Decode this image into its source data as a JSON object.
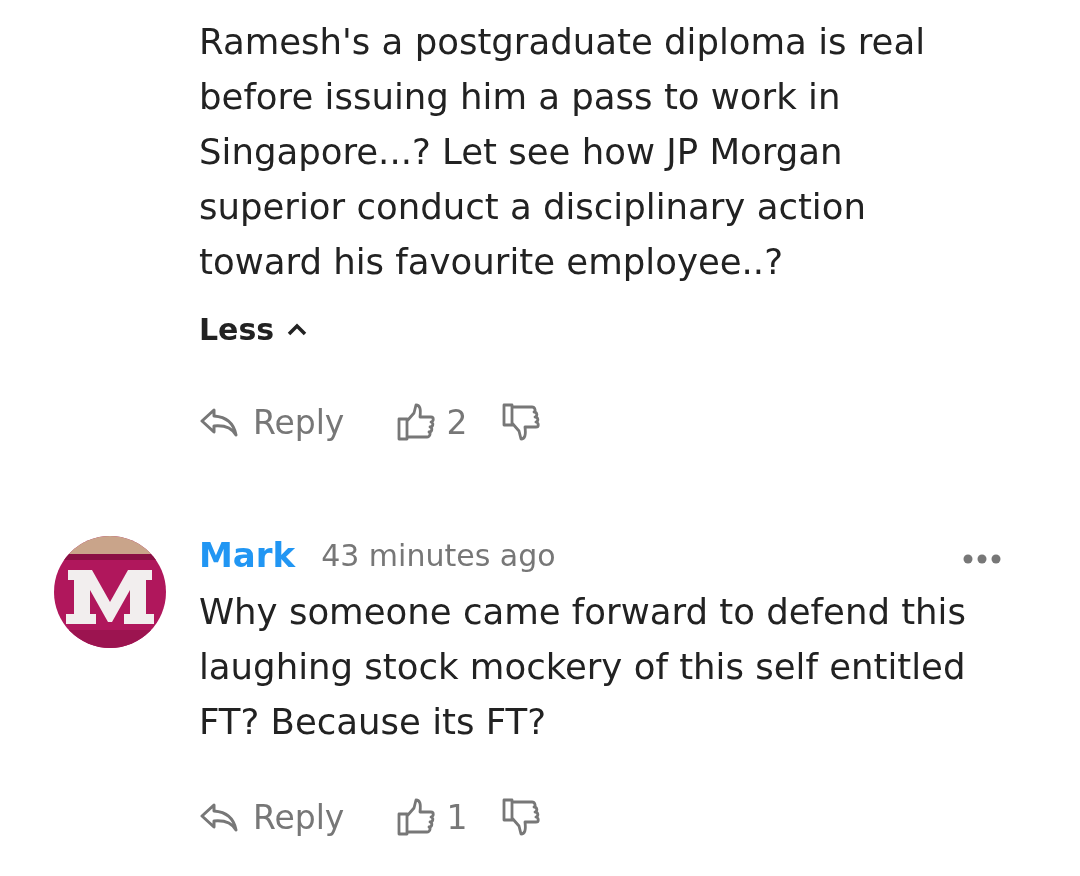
{
  "comments": [
    {
      "text": "Ramesh's a postgraduate diploma is real\nbefore issuing him a pass to work in\nSingapore...? Let see how JP Morgan\nsuperior conduct a disciplinary action\ntoward his favourite employee..?",
      "toggle": "Less",
      "expanded": true,
      "reply": "Reply",
      "likes": "2"
    },
    {
      "author": "Mark",
      "time": "43 minutes ago",
      "text": "Why someone came forward to defend this\nlaughing stock mockery of this self entitled\nFT? Because its FT?",
      "reply": "Reply",
      "likes": "1"
    }
  ]
}
